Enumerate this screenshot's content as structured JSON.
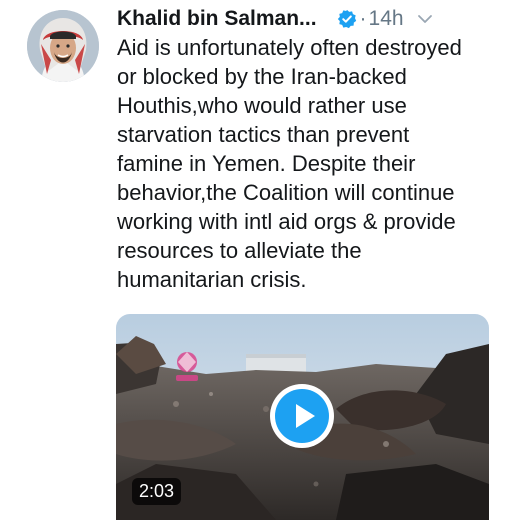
{
  "tweet": {
    "author_name": "Khalid bin Salman...",
    "dot": "·",
    "time": "14h",
    "text": "Aid is unfortunately often destroyed\nor blocked by the Iran-backed\nHouthis,who would rather use\nstarvation tactics than prevent\nfamine in Yemen. Despite their\nbehavior,the Coalition will continue\nworking with intl aid orgs & provide\nresources to alleviate the\nhumanitarian crisis."
  },
  "media": {
    "duration": "2:03"
  },
  "icons": {
    "verified": "verified-badge-icon",
    "more": "chevron-down-icon",
    "play": "play-icon"
  },
  "colors": {
    "verified": "#1da1f2",
    "play": "#1da1f2",
    "text": "#14171a",
    "muted": "#657786"
  }
}
